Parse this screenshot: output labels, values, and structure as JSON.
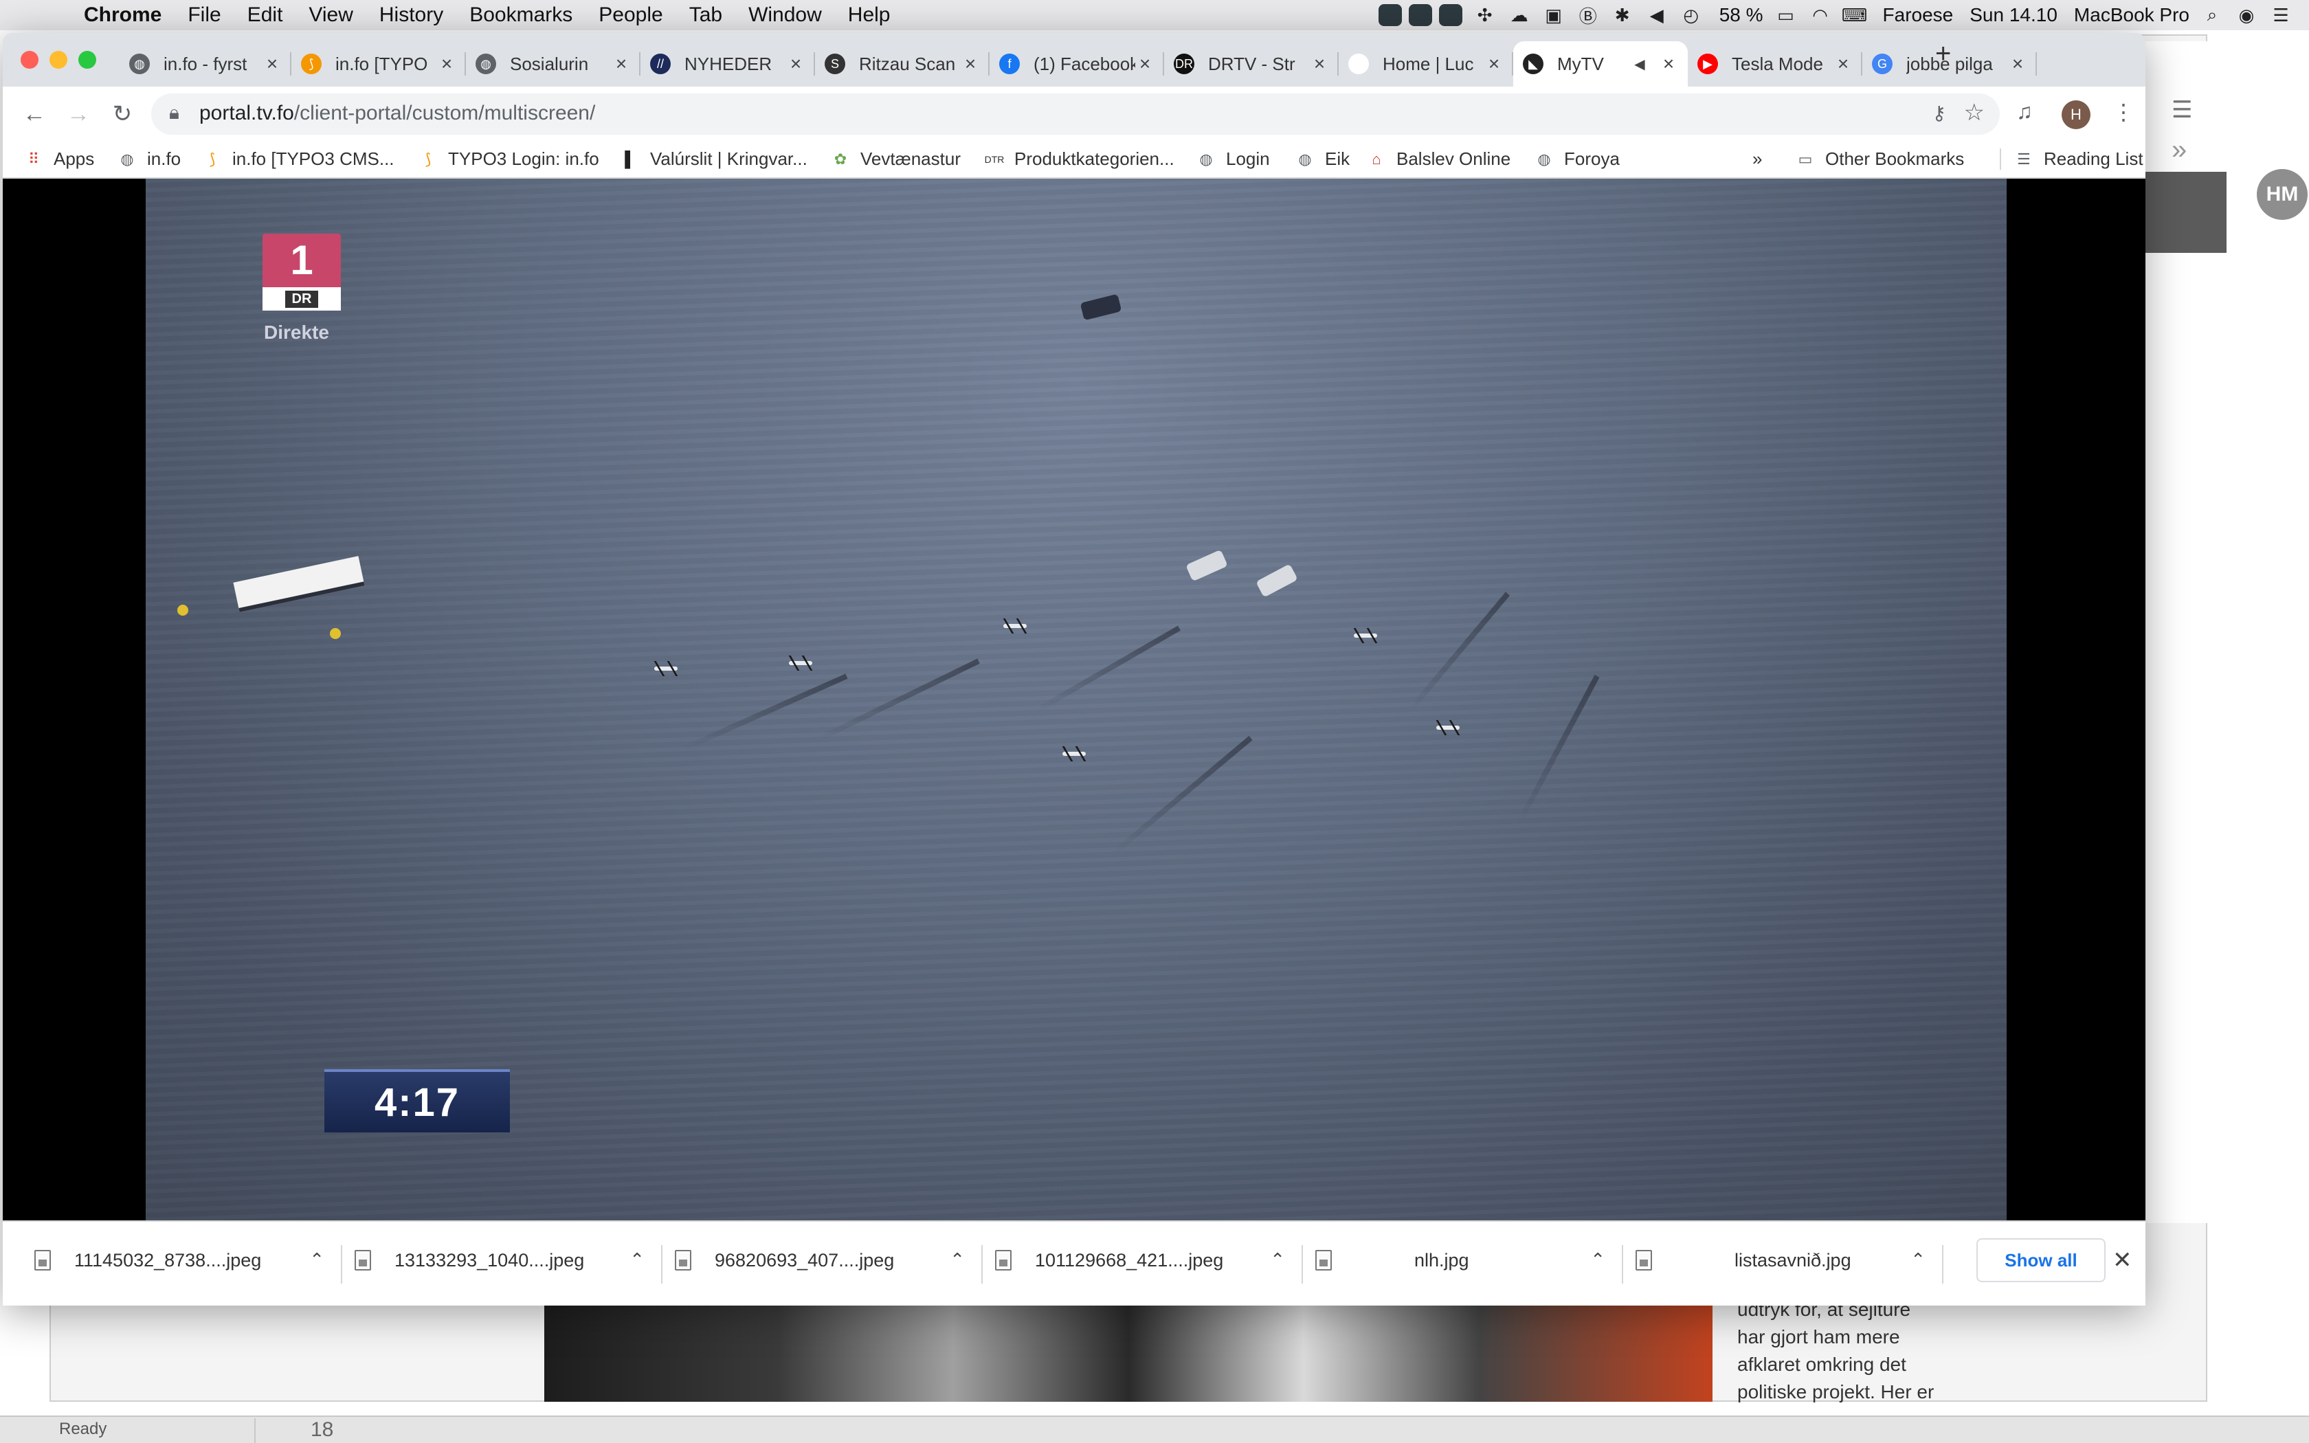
{
  "menubar": {
    "apple_icon": "apple-icon",
    "app_name": "Chrome",
    "items": [
      "File",
      "Edit",
      "View",
      "History",
      "Bookmarks",
      "People",
      "Tab",
      "Window",
      "Help"
    ],
    "battery": "58 %",
    "keyboard": "Faroese",
    "clock": "Sun 14.10",
    "machine": "MacBook Pro"
  },
  "tabs": [
    {
      "title": "in.fo - fyrst",
      "icon": "globe-icon",
      "color": "#5f6368",
      "glyph": "◍"
    },
    {
      "title": "in.fo [TYPO",
      "icon": "typo3-icon",
      "color": "#f49700",
      "glyph": "⟆"
    },
    {
      "title": "Sosialurin",
      "icon": "globe-icon",
      "color": "#5f6368",
      "glyph": "◍"
    },
    {
      "title": "NYHEDER",
      "icon": "news-icon",
      "color": "#1c2b5a",
      "glyph": "//"
    },
    {
      "title": "Ritzau Scan",
      "icon": "ritzau-icon",
      "color": "#333333",
      "glyph": "S"
    },
    {
      "title": "(1) Facebook",
      "icon": "facebook-icon",
      "color": "#1877f2",
      "glyph": "f"
    },
    {
      "title": "DRTV - Str",
      "icon": "drtv-icon",
      "color": "#111111",
      "glyph": "DR"
    },
    {
      "title": "Home | Luc",
      "icon": "blank-icon",
      "color": "#ffffff",
      "glyph": ""
    },
    {
      "title": "MyTV",
      "icon": "mytv-icon",
      "color": "#222222",
      "glyph": "◣",
      "active": true
    },
    {
      "title": "Tesla Mode",
      "icon": "youtube-icon",
      "color": "#ff0000",
      "glyph": "▶"
    },
    {
      "title": "jobbe pilga",
      "icon": "google-icon",
      "color": "#4285f4",
      "glyph": "G"
    }
  ],
  "toolbar": {
    "url_host": "portal.tv.fo",
    "url_path": "/client-portal/custom/multiscreen/",
    "profile_initial": "H"
  },
  "bookmarks": {
    "items": [
      {
        "label": "Apps",
        "icon": "apps-grid-icon",
        "glyph": "⠿",
        "color": "#e34133"
      },
      {
        "label": "in.fo",
        "icon": "globe-icon",
        "glyph": "◍",
        "color": "#5f6368"
      },
      {
        "label": "in.fo [TYPO3 CMS...",
        "icon": "typo3-icon",
        "glyph": "⟆",
        "color": "#f49700"
      },
      {
        "label": "TYPO3 Login: in.fo",
        "icon": "typo3-icon",
        "glyph": "⟆",
        "color": "#f49700"
      },
      {
        "label": "Valúrslit | Kringvar...",
        "icon": "kringvarp-icon",
        "glyph": "▌",
        "color": "#222222"
      },
      {
        "label": "Vevtænastur",
        "icon": "leaf-icon",
        "glyph": "✿",
        "color": "#6aa84f"
      },
      {
        "label": "Produktkategorien...",
        "icon": "dtr-icon",
        "glyph": "DTR",
        "color": "#333333"
      },
      {
        "label": "Login",
        "icon": "globe-icon",
        "glyph": "◍",
        "color": "#5f6368"
      },
      {
        "label": "Eik",
        "icon": "globe-icon",
        "glyph": "◍",
        "color": "#5f6368"
      },
      {
        "label": "Balslev Online",
        "icon": "house-icon",
        "glyph": "⌂",
        "color": "#c0392b"
      },
      {
        "label": "Foroya",
        "icon": "globe-icon",
        "glyph": "◍",
        "color": "#5f6368"
      }
    ],
    "overflow": "»",
    "other": "Other Bookmarks",
    "reading_list": "Reading List"
  },
  "video": {
    "channel_number": "1",
    "channel_brand": "DR",
    "live_label": "Direkte",
    "timer": "4:17",
    "brand_color": "#c8466a"
  },
  "downloads": {
    "items": [
      {
        "name": "11145032_8738....jpeg"
      },
      {
        "name": "13133293_1040....jpeg"
      },
      {
        "name": "96820693_407....jpeg"
      },
      {
        "name": "101129668_421....jpeg"
      },
      {
        "name": "nlh.jpg"
      },
      {
        "name": "listasavnið.jpg"
      }
    ],
    "show_all": "Show all"
  },
  "background": {
    "avatar_initials": "HM",
    "article_lines": [
      "udtryk for, at sejlture",
      "har gjort ham mere",
      "afklaret omkring det",
      "politiske projekt. Her er"
    ],
    "status_text": "Ready",
    "status_number": "18"
  }
}
